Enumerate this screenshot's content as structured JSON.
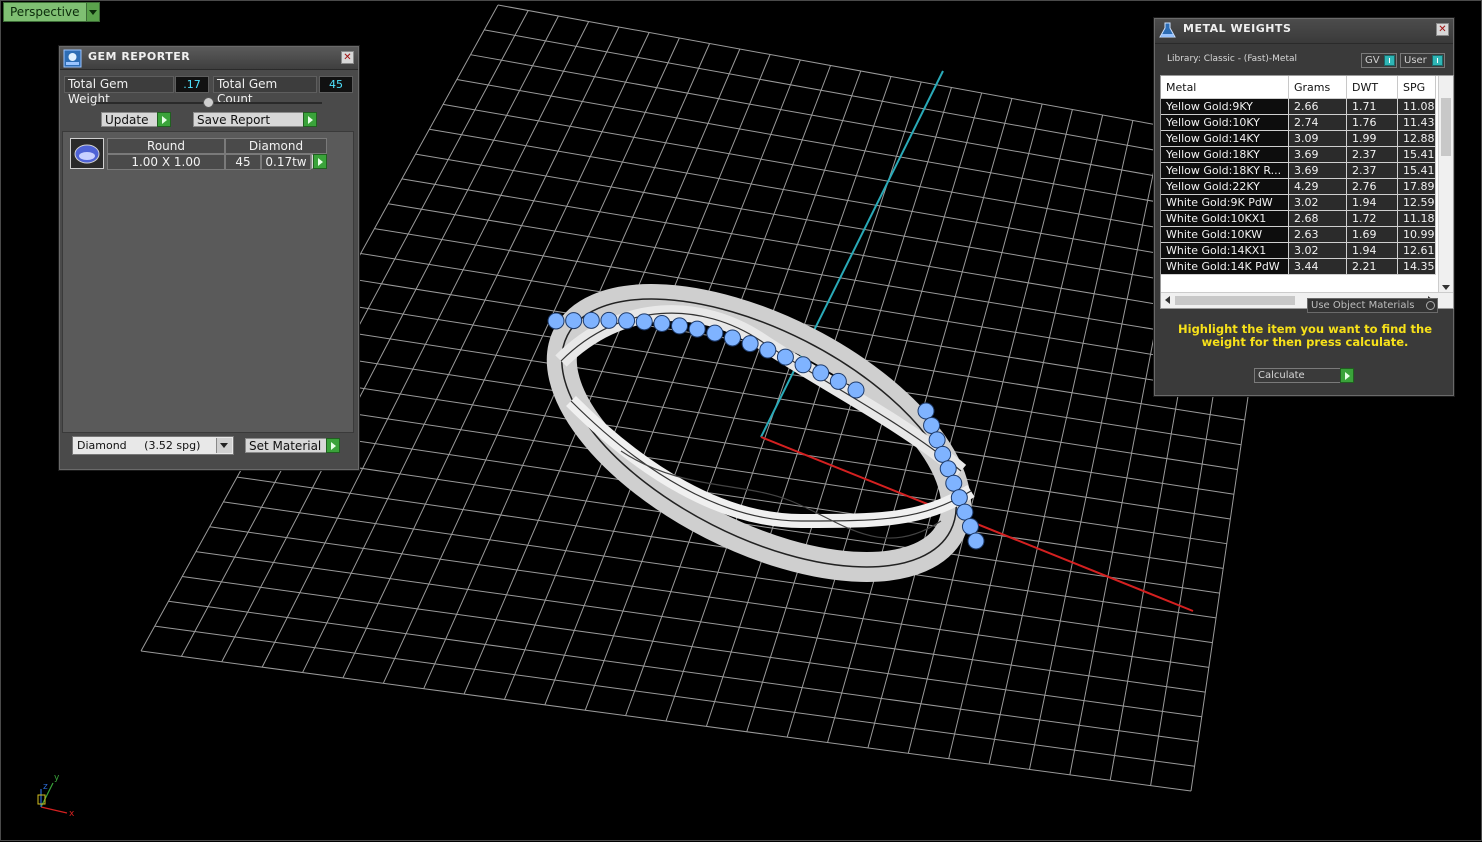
{
  "viewport": {
    "label": "Perspective"
  },
  "gem_reporter": {
    "title": "GEM REPORTER",
    "total_weight_label": "Total Gem Weight",
    "total_weight_value": ".17",
    "total_count_label": "Total Gem Count",
    "total_count_value": "45",
    "update_label": "Update",
    "save_report_label": "Save Report",
    "gem": {
      "shape": "Round",
      "type": "Diamond",
      "size": "1.00 X 1.00",
      "count": "45",
      "weight": "0.17tw"
    },
    "material_select": "Diamond     (3.52 spg)",
    "set_material_label": "Set Material"
  },
  "metal_weights": {
    "title": "METAL WEIGHTS",
    "library": "Library: Classic - (Fast)-Metal",
    "gv_label": "GV",
    "user_label": "User",
    "columns": [
      "Metal",
      "Grams",
      "DWT",
      "SPG"
    ],
    "rows": [
      [
        "Yellow Gold:9KY",
        "2.66",
        "1.71",
        "11.08"
      ],
      [
        "Yellow Gold:10KY",
        "2.74",
        "1.76",
        "11.43"
      ],
      [
        "Yellow Gold:14KY",
        "3.09",
        "1.99",
        "12.88"
      ],
      [
        "Yellow Gold:18KY",
        "3.69",
        "2.37",
        "15.41"
      ],
      [
        "Yellow Gold:18KY R...",
        "3.69",
        "2.37",
        "15.41"
      ],
      [
        "Yellow Gold:22KY",
        "4.29",
        "2.76",
        "17.89"
      ],
      [
        "White Gold:9K PdW",
        "3.02",
        "1.94",
        "12.59"
      ],
      [
        "White Gold:10KX1",
        "2.68",
        "1.72",
        "11.18"
      ],
      [
        "White Gold:10KW",
        "2.63",
        "1.69",
        "10.99"
      ],
      [
        "White Gold:14KX1",
        "3.02",
        "1.94",
        "12.61"
      ],
      [
        "White Gold:14K PdW",
        "3.44",
        "2.21",
        "14.35"
      ]
    ],
    "use_object_materials": "Use Object Materials",
    "hint": "Highlight the item you want to find the weight for then press calculate.",
    "calculate_label": "Calculate"
  },
  "axis": {
    "x": "x",
    "y": "y",
    "z": "z"
  }
}
